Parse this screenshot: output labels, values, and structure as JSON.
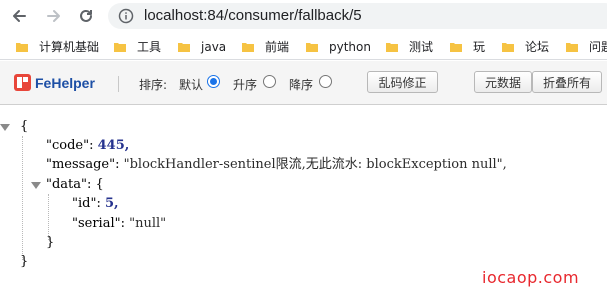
{
  "address_bar": {
    "url": "localhost:84/consumer/fallback/5"
  },
  "bookmarks": [
    {
      "label": "计算机基础",
      "icon": "folder-icon"
    },
    {
      "label": "工具",
      "icon": "folder-icon"
    },
    {
      "label": "java",
      "icon": "folder-icon"
    },
    {
      "label": "前端",
      "icon": "folder-icon"
    },
    {
      "label": "python",
      "icon": "folder-icon"
    },
    {
      "label": "测试",
      "icon": "folder-icon"
    },
    {
      "label": "玩",
      "icon": "folder-icon"
    },
    {
      "label": "论坛",
      "icon": "folder-icon"
    },
    {
      "label": "问题",
      "icon": "folder-icon"
    }
  ],
  "fehelper": {
    "name": "FeHelper",
    "sort_label": "排序:",
    "sort_options": [
      {
        "label": "默认",
        "checked": true
      },
      {
        "label": "升序",
        "checked": false
      },
      {
        "label": "降序",
        "checked": false
      }
    ],
    "buttons": {
      "fix_encoding": "乱码修正",
      "raw_data": "元数据",
      "collapse_all": "折叠所有"
    }
  },
  "json_view": {
    "open_brace": "{",
    "close_brace": "}",
    "code_key": "\"code\":",
    "code_value": "445,",
    "message_key": "\"message\":",
    "message_value": "\"blockHandler-sentinel限流,无此流水: blockException null\",",
    "data_key": "\"data\":",
    "data_open": "{",
    "id_key": "\"id\":",
    "id_value": "5,",
    "serial_key": "\"serial\":",
    "serial_value": "\"null\"",
    "data_close": "}"
  },
  "watermark": "iocaop.com",
  "colors": {
    "accent_blue": "#1a73e8",
    "fehelper_red": "#e8463a",
    "fehelper_blue": "#1d4fa5",
    "number_color": "#25328e",
    "watermark_red": "#e8282e",
    "folder_yellow": "#f6c343"
  }
}
